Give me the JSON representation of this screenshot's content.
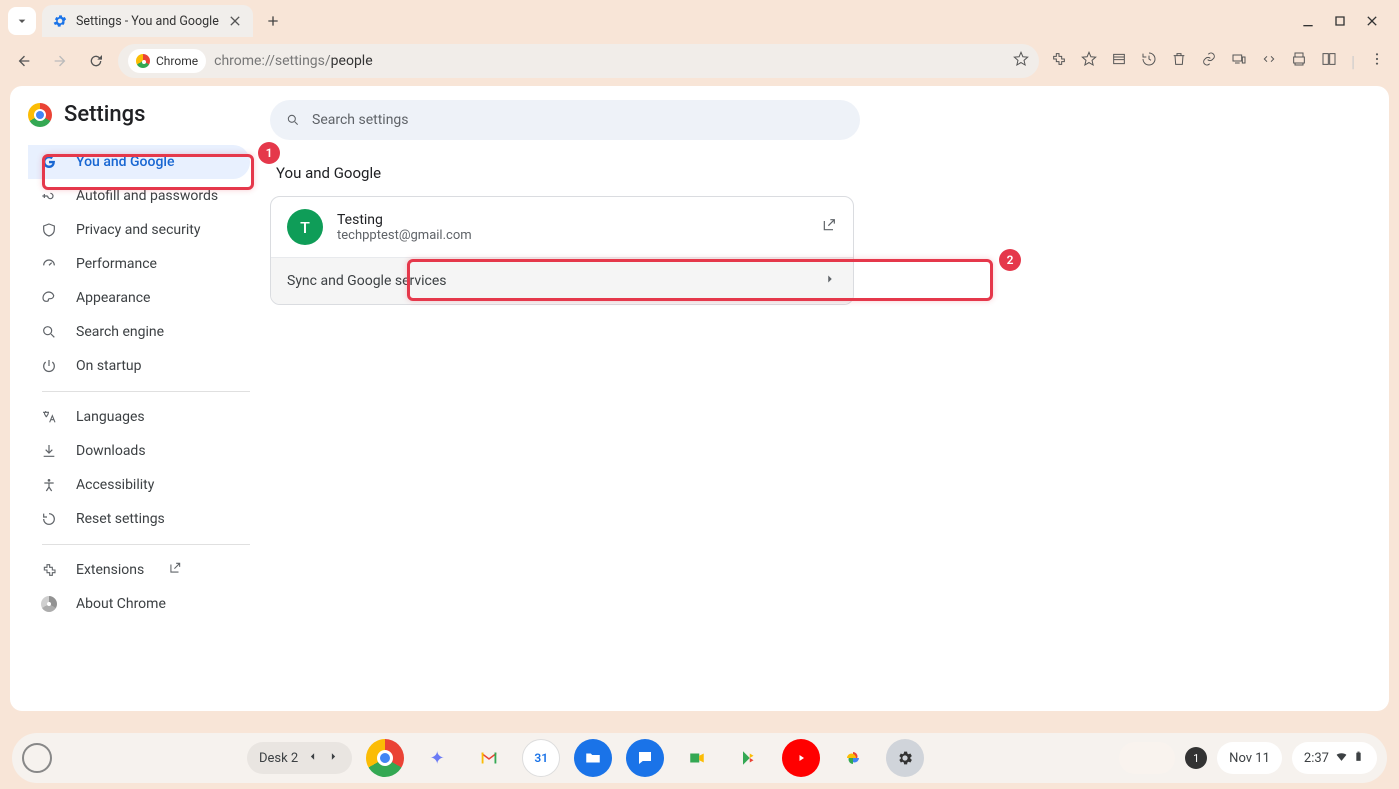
{
  "tab": {
    "title": "Settings - You and Google"
  },
  "omnibox": {
    "chip_label": "Chrome",
    "url_prefix": "chrome://settings/",
    "url_suffix": "people"
  },
  "settings": {
    "brand": "Settings",
    "search_placeholder": "Search settings",
    "sidebar": {
      "items1": [
        {
          "label": "You and Google",
          "icon": "G"
        },
        {
          "label": "Autofill and passwords",
          "icon": "key"
        },
        {
          "label": "Privacy and security",
          "icon": "shield"
        },
        {
          "label": "Performance",
          "icon": "speed"
        },
        {
          "label": "Appearance",
          "icon": "paint"
        },
        {
          "label": "Search engine",
          "icon": "search"
        },
        {
          "label": "On startup",
          "icon": "power"
        }
      ],
      "items2": [
        {
          "label": "Languages",
          "icon": "lang"
        },
        {
          "label": "Downloads",
          "icon": "download"
        },
        {
          "label": "Accessibility",
          "icon": "a11y"
        },
        {
          "label": "Reset settings",
          "icon": "reset"
        }
      ],
      "items3": [
        {
          "label": "Extensions",
          "icon": "ext",
          "external": true
        },
        {
          "label": "About Chrome",
          "icon": "chrome"
        }
      ]
    },
    "main": {
      "section_title": "You and Google",
      "account": {
        "avatar_letter": "T",
        "name": "Testing",
        "email": "techpptest@gmail.com"
      },
      "sync_row": "Sync and Google services"
    }
  },
  "annotations": {
    "badge1": "1",
    "badge2": "2"
  },
  "shelf": {
    "desk": "Desk 2",
    "date": "Nov 11",
    "time": "2:37",
    "notif_count": "1",
    "cal_day": "31"
  }
}
